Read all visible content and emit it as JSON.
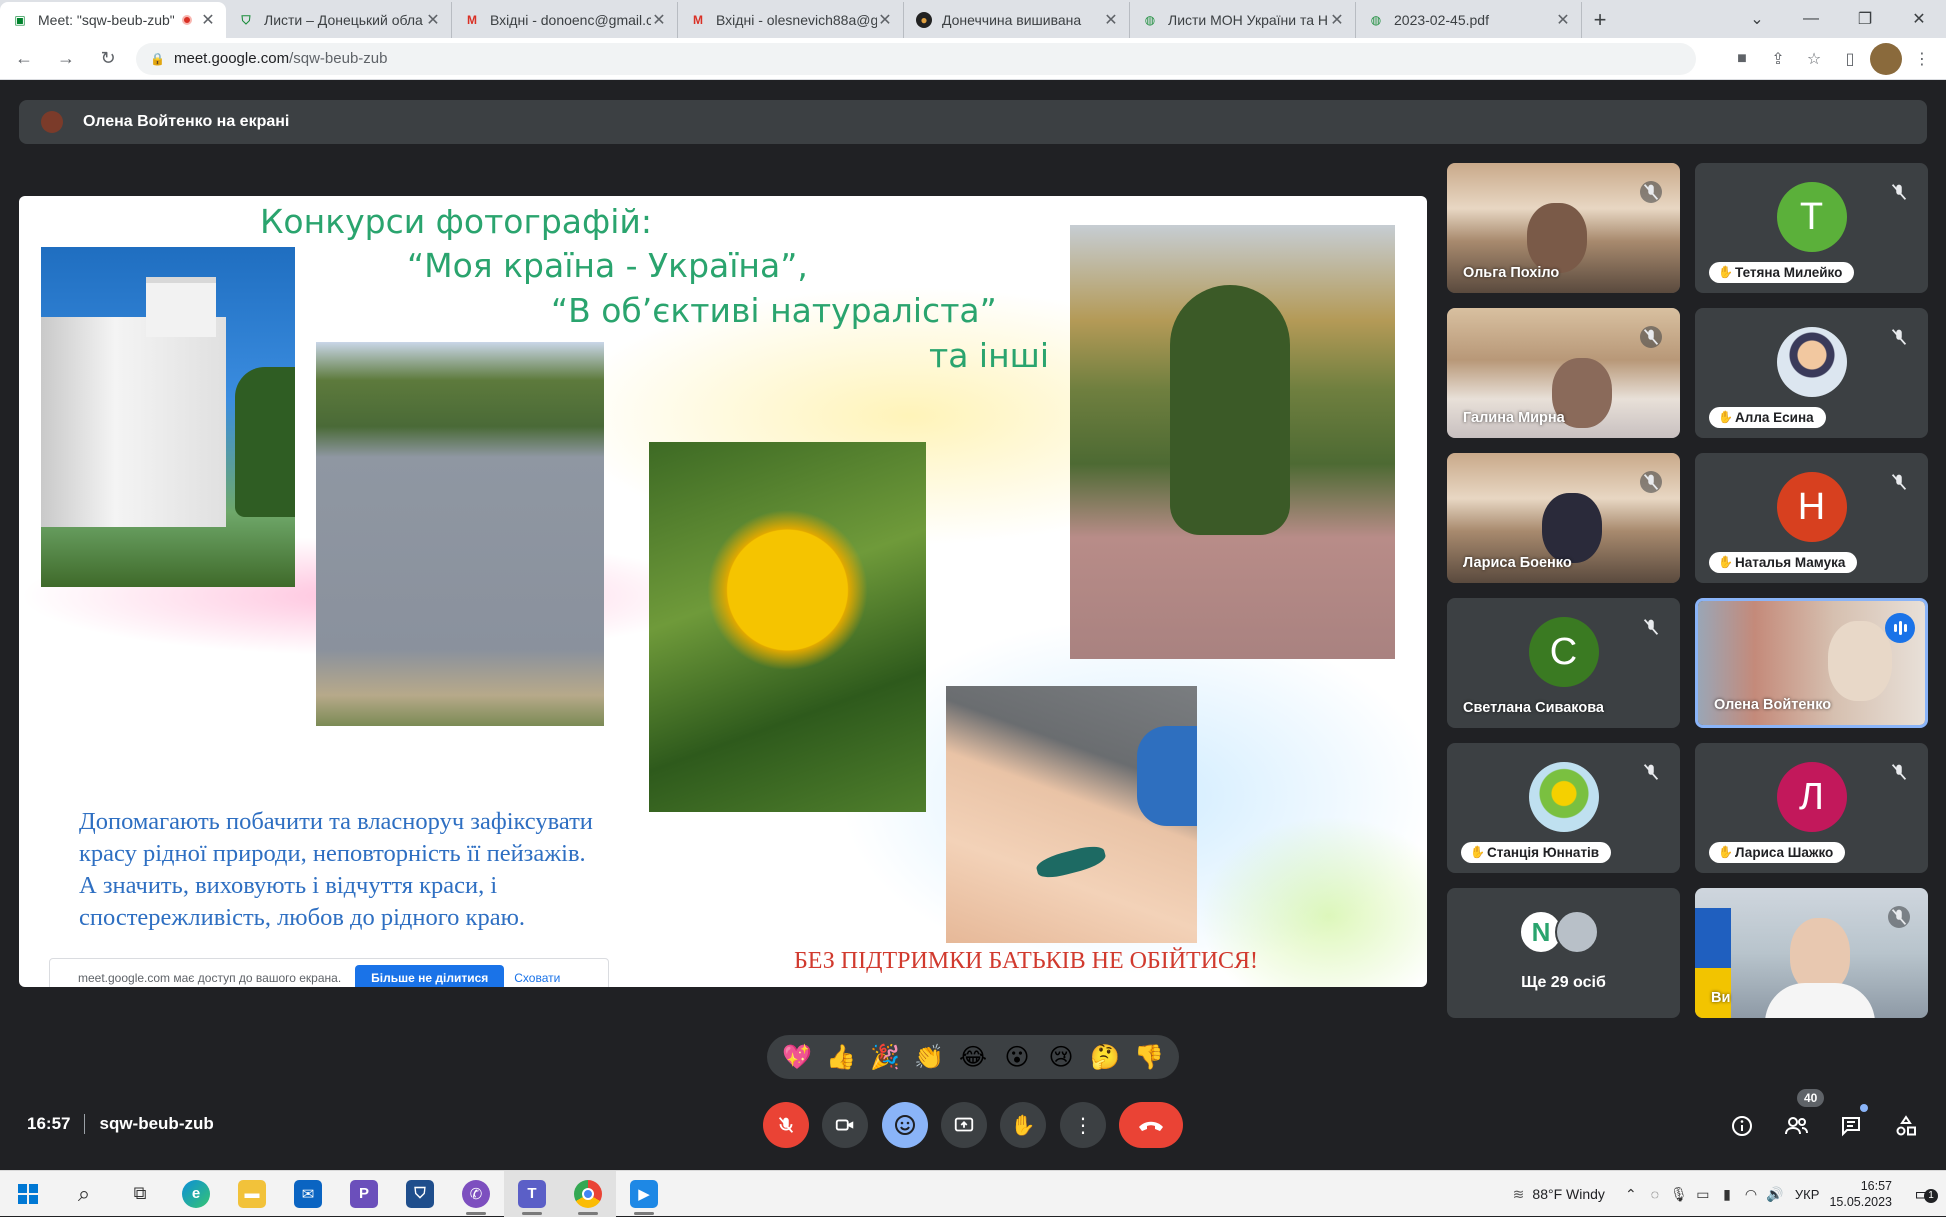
{
  "browser": {
    "tabs": [
      {
        "title": "Meet: \"sqw-beub-zub\"",
        "favicon": "meet-icon",
        "active": true,
        "recording": true
      },
      {
        "title": "Листи – Донецький обла",
        "favicon": "shield-icon"
      },
      {
        "title": "Вхідні - donoenc@gmail.c",
        "favicon": "gmail-icon"
      },
      {
        "title": "Вхідні - olesnevich88a@g",
        "favicon": "gmail-icon"
      },
      {
        "title": "Донеччина вишивана",
        "favicon": "dark-logo-icon"
      },
      {
        "title": "Листи МОН України та Н",
        "favicon": "globe-icon"
      },
      {
        "title": "2023-02-45.pdf",
        "favicon": "globe-icon"
      }
    ],
    "url_host": "meet.google.com",
    "url_path": "/sqw-beub-zub"
  },
  "meet": {
    "presenting_label": "Олена Войтенко на екрані",
    "slide": {
      "title_line1": "Конкурси фотографій:",
      "title_line2": "“Моя країна - Україна”,",
      "title_line3": "“В об’єктиві натураліста”",
      "title_line4": "та інші",
      "body_line1": "Допомагають побачити та власноруч зафіксувати",
      "body_line2": "красу рідної природи, неповторність її пейзажів.",
      "body_line3": "А значить, виховують і відчуття краси, і",
      "body_line4": "спостережливість, любов до рідного краю.",
      "footer_red": "БЕЗ ПІДТРИМКИ БАТЬКІВ НЕ ОБІЙТИСЯ!",
      "share_notice": "meet.google.com має доступ до вашого екрана.",
      "share_stop": "Більше не ділитися",
      "share_hide": "Сховати"
    },
    "participants": [
      {
        "name": "Ольга Похіло",
        "type": "video",
        "muted": true
      },
      {
        "name": "Тетяна Милейко",
        "type": "letter",
        "letter": "Т",
        "color": "#5bb03a",
        "muted": true
      },
      {
        "name": "Галина Мирна",
        "type": "video",
        "muted": true
      },
      {
        "name": "Алла Есина",
        "type": "avatar",
        "muted": true
      },
      {
        "name": "Лариса Боенко",
        "type": "video",
        "muted": true
      },
      {
        "name": "Наталья Мамука",
        "type": "letter",
        "letter": "Н",
        "color": "#d7401f",
        "muted": true
      },
      {
        "name": "Светлана Сивакова",
        "type": "letter",
        "letter": "С",
        "color": "#3a7a22",
        "muted": true
      },
      {
        "name": "Олена Войтенко",
        "type": "video",
        "speaking": true
      },
      {
        "name": "Станція Юннатів",
        "type": "avatar",
        "muted": true
      },
      {
        "name": "Лариса Шажко",
        "type": "letter",
        "letter": "Л",
        "color": "#c2185b",
        "muted": true
      },
      {
        "name": "Ще 29 осіб",
        "type": "more",
        "letter": "N"
      },
      {
        "name": "Ви",
        "type": "video",
        "muted": true
      }
    ],
    "reactions": [
      "💖",
      "👍",
      "🎉",
      "👏",
      "😂",
      "😮",
      "😢",
      "🤔",
      "👎"
    ],
    "time": "16:57",
    "meeting_code": "sqw-beub-zub",
    "people_count": "40"
  },
  "taskbar": {
    "weather": "88°F  Windy",
    "lang": "УКР",
    "time": "16:57",
    "date": "15.05.2023",
    "notification_count": "1"
  }
}
